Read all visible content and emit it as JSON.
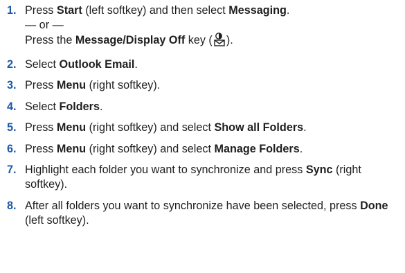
{
  "steps": [
    {
      "num": "1.",
      "line1": {
        "a": "Press ",
        "b": "Start",
        "c": " (left softkey) and then select ",
        "d": "Messaging",
        "e": "."
      },
      "or_text": "— or —",
      "line3": {
        "a": "Press the ",
        "b": "Message/Display Off",
        "c": " key (",
        "icon": "message-display-off-key-icon",
        "d": ")."
      }
    },
    {
      "num": "2.",
      "a": "Select ",
      "b": "Outlook Email",
      "c": "."
    },
    {
      "num": "3.",
      "a": "Press ",
      "b": "Menu",
      "c": " (right softkey)."
    },
    {
      "num": "4.",
      "a": "Select ",
      "b": "Folders",
      "c": "."
    },
    {
      "num": "5.",
      "a": "Press ",
      "b": "Menu",
      "c": " (right softkey) and select ",
      "d": "Show all Folders",
      "e": "."
    },
    {
      "num": "6.",
      "a": "Press ",
      "b": "Menu",
      "c": " (right softkey) and select ",
      "d": "Manage Folders",
      "e": "."
    },
    {
      "num": "7.",
      "a": "Highlight each folder you want to synchronize and press ",
      "b": "Sync",
      "c": " (right softkey)."
    },
    {
      "num": "8.",
      "a": "After all folders you want to synchronize have been selected, press ",
      "b": "Done",
      "c": " (left softkey)."
    }
  ],
  "colors": {
    "step_number": "#1e5aa8",
    "text": "#1f1f1f"
  }
}
